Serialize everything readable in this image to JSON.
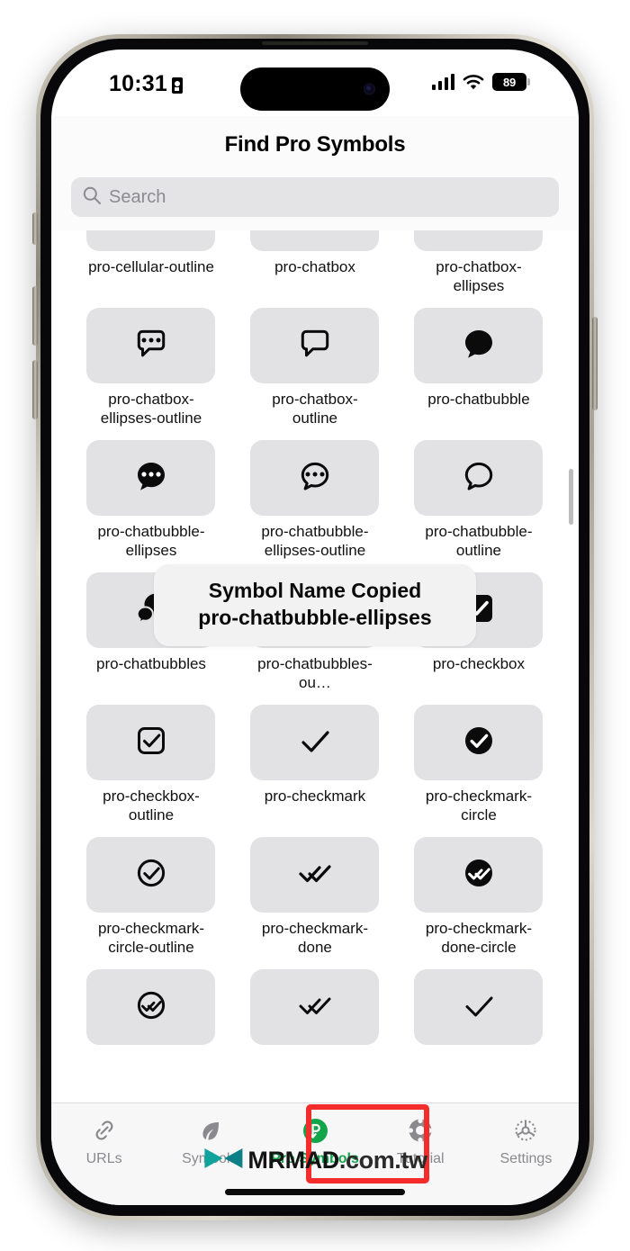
{
  "status_bar": {
    "time": "10:31",
    "lock_icon": "lock-portrait-icon",
    "cellular_icon": "cellular-signal-icon",
    "wifi_icon": "wifi-icon",
    "battery_percent": "89"
  },
  "header": {
    "title": "Find Pro Symbols",
    "search": {
      "icon": "search-icon",
      "placeholder": "Search",
      "value": ""
    }
  },
  "grid": {
    "rows": [
      [
        {
          "label": "pro-cellular-outline",
          "icon": "cellular-outline-icon",
          "clipped": true
        },
        {
          "label": "pro-chatbox",
          "icon": "chatbox-filled-icon",
          "clipped": true
        },
        {
          "label": "pro-chatbox-ellipses",
          "icon": "chatbox-ellipses-icon",
          "clipped": true
        }
      ],
      [
        {
          "label": "pro-chatbox-ellipses-outline",
          "icon": "chatbox-ellipses-outline-icon"
        },
        {
          "label": "pro-chatbox-outline",
          "icon": "chatbox-outline-icon"
        },
        {
          "label": "pro-chatbubble",
          "icon": "chatbubble-filled-icon"
        }
      ],
      [
        {
          "label": "pro-chatbubble-ellipses",
          "icon": "chatbubble-ellipses-filled-icon"
        },
        {
          "label": "pro-chatbubble-ellipses-outline",
          "icon": "chatbubble-ellipses-outline-icon"
        },
        {
          "label": "pro-chatbubble-outline",
          "icon": "chatbubble-outline-icon"
        }
      ],
      [
        {
          "label": "pro-chatbubbles",
          "icon": "chatbubbles-filled-icon"
        },
        {
          "label": "pro-chatbubbles-ou…",
          "icon": "chatbubbles-outline-icon"
        },
        {
          "label": "pro-checkbox",
          "icon": "checkbox-filled-icon"
        }
      ],
      [
        {
          "label": "pro-checkbox-outline",
          "icon": "checkbox-outline-icon"
        },
        {
          "label": "pro-checkmark",
          "icon": "checkmark-icon"
        },
        {
          "label": "pro-checkmark-circle",
          "icon": "checkmark-circle-filled-icon"
        }
      ],
      [
        {
          "label": "pro-checkmark-circle-outline",
          "icon": "checkmark-circle-outline-icon"
        },
        {
          "label": "pro-checkmark-done",
          "icon": "checkmark-done-icon"
        },
        {
          "label": "pro-checkmark-done-circle",
          "icon": "checkmark-done-circle-filled-icon"
        }
      ],
      [
        {
          "label": "",
          "icon": "checkmark-done-circle-outline-icon",
          "clipped": true
        },
        {
          "label": "",
          "icon": "checkmark-done-outline-icon",
          "clipped": true
        },
        {
          "label": "",
          "icon": "checkmark-sharp-icon",
          "clipped": true
        }
      ]
    ]
  },
  "toast": {
    "line1": "Symbol Name Copied",
    "line2": "pro-chatbubble-ellipses"
  },
  "tabbar": {
    "tabs": [
      {
        "label": "URLs",
        "icon": "link-icon",
        "active": false
      },
      {
        "label": "Symbols",
        "icon": "leaf-icon",
        "active": false
      },
      {
        "label": "Pro Symbols",
        "icon": "pro-badge-icon",
        "active": true
      },
      {
        "label": "Tutorial",
        "icon": "life-ring-icon",
        "active": false
      },
      {
        "label": "Settings",
        "icon": "gear-icon",
        "active": false
      }
    ]
  },
  "annotation": {
    "highlight_color": "#f42c2c",
    "target": "Pro Symbols"
  },
  "watermark": {
    "logo": "mrmad-logo-icon",
    "text_bold": "MRMAD",
    "text_rest": ".com.tw"
  },
  "colors": {
    "accent_green": "#12a54a",
    "tile_bg": "#e2e2e4",
    "tab_inactive": "#8a8a8e",
    "toast_bg": "#f2f2f3"
  }
}
